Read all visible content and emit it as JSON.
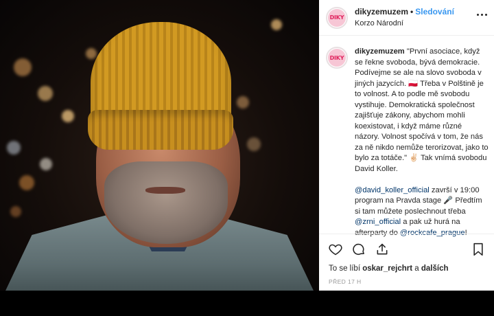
{
  "account": {
    "username": "dikyzemuzem",
    "logo_text": "DIKY",
    "follow_label": "Sledování",
    "separator": "•",
    "location": "Korzo Národní"
  },
  "caption": {
    "username": "dikyzemuzem",
    "paragraph1_a": "\"První asociace, když se řekne svoboda, bývá demokracie. Podívejme se ale na slovo svoboda v jiných jazycích. ",
    "flag_icon": "poland-flag-icon",
    "flag_glyph": "🇵🇱",
    "paragraph1_b": " Třeba v Polštině je to volnost. A to podle mě svobodu vystihuje. Demokratická společnost zajišťuje zákony, abychom mohli koexistovat, i když máme různé názory. Volnost spočívá v tom, že nás za ně nikdo nemůže terorizovat, jako to bylo za totáče.\" ",
    "peace_glyph": "✌🏻",
    "paragraph1_c": " Tak vnímá svobodu David Koller.",
    "mention1": "@david_koller_official",
    "paragraph2_a": " završí v 19:00 program na Pravda stage ",
    "mic_glyph": "🎤",
    "paragraph2_b": " Předtím si tam můžete poslechnout třeba ",
    "mention2": "@zrni_official",
    "paragraph2_c": " a pak už hurá na afterparty do ",
    "mention3": "@rockcafe_prague",
    "paragraph2_d": "!"
  },
  "likes": {
    "prefix": "To se líbí ",
    "user": "oskar_rejchrt",
    "middle": " a ",
    "others": "dalších"
  },
  "timestamp": "PŘED 17 H",
  "icons": [
    "heart-icon",
    "comment-icon",
    "share-icon",
    "bookmark-icon",
    "more-options-icon"
  ]
}
